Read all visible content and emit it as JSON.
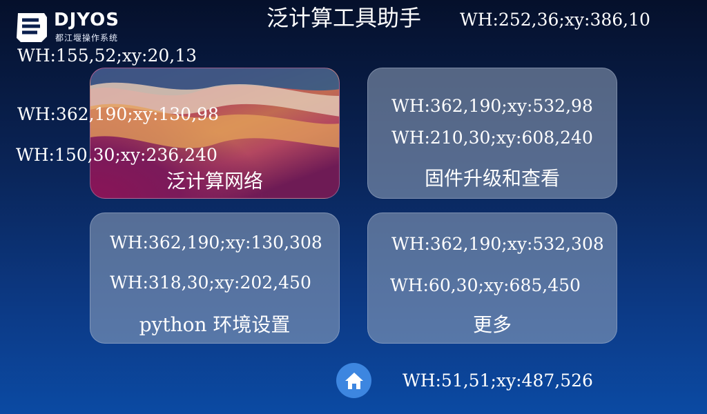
{
  "logo": {
    "brand": "DJYOS",
    "subtitle": "都江堰操作系统",
    "note": "WH:155,52;xy:20,13"
  },
  "header": {
    "title": "泛计算工具助手",
    "note": "WH:252,36;xy:386,10"
  },
  "cards": [
    {
      "label": "泛计算网络",
      "card_note": "WH:362,190;xy:130,98",
      "label_note": "WH:150,30;xy:236,240"
    },
    {
      "label": "固件升级和查看",
      "card_note": "WH:362,190;xy:532,98",
      "label_note": "WH:210,30;xy:608,240"
    },
    {
      "label": "python 环境设置",
      "card_note": "WH:362,190;xy:130,308",
      "label_note": "WH:318,30;xy:202,450"
    },
    {
      "label": "更多",
      "card_note": "WH:362,190;xy:532,308",
      "label_note": "WH:60,30;xy:685,450"
    }
  ],
  "home": {
    "icon": "home-icon",
    "note": "WH:51,51;xy:487,526"
  },
  "colors": {
    "accent": "#3d86e0",
    "card": "#9aa6bf"
  }
}
